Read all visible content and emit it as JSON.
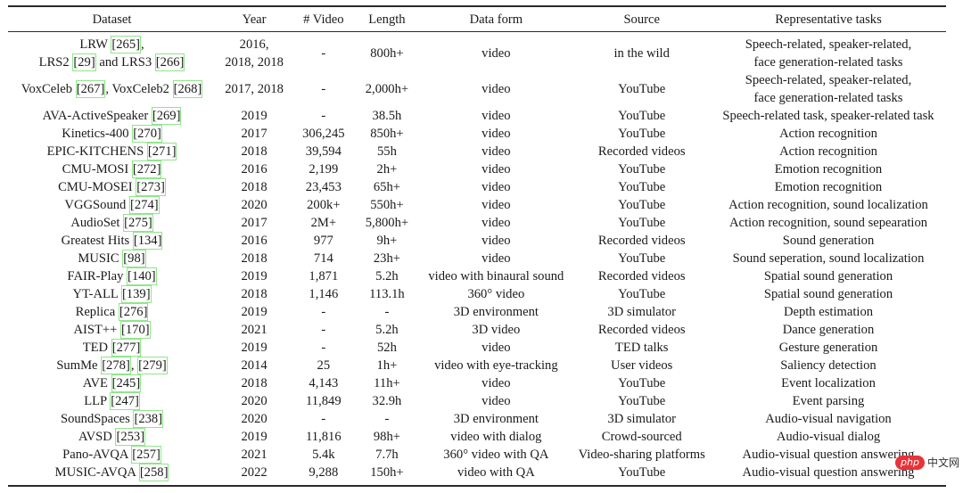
{
  "table": {
    "headers": [
      "Dataset",
      "Year",
      "# Video",
      "Length",
      "Data form",
      "Source",
      "Representative tasks"
    ],
    "rows": [
      {
        "dataset_lines": [
          [
            {
              "t": "LRW "
            },
            {
              "c": "[265]"
            },
            {
              "t": ","
            }
          ],
          [
            {
              "t": "LRS2 "
            },
            {
              "c": "[29]"
            },
            {
              "t": " and LRS3 "
            },
            {
              "c": "[266]"
            }
          ]
        ],
        "year": [
          "2016,",
          "2018, 2018"
        ],
        "num_video": "-",
        "length": "800h+",
        "data_form": "video",
        "source": "in the wild",
        "tasks": [
          "Speech-related, speaker-related,",
          "face generation-related tasks"
        ]
      },
      {
        "dataset_lines": [
          [
            {
              "t": "VoxCeleb "
            },
            {
              "c": "[267]"
            },
            {
              "t": ", VoxCeleb2 "
            },
            {
              "c": "[268]"
            }
          ]
        ],
        "year": [
          "2017, 2018"
        ],
        "num_video": "-",
        "length": "2,000h+",
        "data_form": "video",
        "source": "YouTube",
        "tasks": [
          "Speech-related, speaker-related,",
          "face generation-related tasks"
        ]
      },
      {
        "dataset_lines": [
          [
            {
              "t": "AVA-ActiveSpeaker "
            },
            {
              "c": "[269]"
            }
          ]
        ],
        "year": [
          "2019"
        ],
        "num_video": "-",
        "length": "38.5h",
        "data_form": "video",
        "source": "YouTube",
        "tasks": [
          "Speech-related task, speaker-related task"
        ]
      },
      {
        "dataset_lines": [
          [
            {
              "t": "Kinetics-400 "
            },
            {
              "c": "[270]"
            }
          ]
        ],
        "year": [
          "2017"
        ],
        "num_video": "306,245",
        "length": "850h+",
        "data_form": "video",
        "source": "YouTube",
        "tasks": [
          "Action recognition"
        ]
      },
      {
        "dataset_lines": [
          [
            {
              "t": "EPIC-KITCHENS "
            },
            {
              "c": "[271]"
            }
          ]
        ],
        "year": [
          "2018"
        ],
        "num_video": "39,594",
        "length": "55h",
        "data_form": "video",
        "source": "Recorded videos",
        "tasks": [
          "Action recognition"
        ]
      },
      {
        "dataset_lines": [
          [
            {
              "t": "CMU-MOSI "
            },
            {
              "c": "[272]"
            }
          ]
        ],
        "year": [
          "2016"
        ],
        "num_video": "2,199",
        "length": "2h+",
        "data_form": "video",
        "source": "YouTube",
        "tasks": [
          "Emotion recognition"
        ]
      },
      {
        "dataset_lines": [
          [
            {
              "t": "CMU-MOSEI "
            },
            {
              "c": "[273]"
            }
          ]
        ],
        "year": [
          "2018"
        ],
        "num_video": "23,453",
        "length": "65h+",
        "data_form": "video",
        "source": "YouTube",
        "tasks": [
          "Emotion recognition"
        ]
      },
      {
        "dataset_lines": [
          [
            {
              "t": "VGGSound "
            },
            {
              "c": "[274]"
            }
          ]
        ],
        "year": [
          "2020"
        ],
        "num_video": "200k+",
        "length": "550h+",
        "data_form": "video",
        "source": "YouTube",
        "tasks": [
          "Action recognition, sound localization"
        ]
      },
      {
        "dataset_lines": [
          [
            {
              "t": "AudioSet "
            },
            {
              "c": "[275]"
            }
          ]
        ],
        "year": [
          "2017"
        ],
        "num_video": "2M+",
        "length": "5,800h+",
        "data_form": "video",
        "source": "YouTube",
        "tasks": [
          "Action recognition, sound sepearation"
        ]
      },
      {
        "dataset_lines": [
          [
            {
              "t": "Greatest Hits "
            },
            {
              "c": "[134]"
            }
          ]
        ],
        "year": [
          "2016"
        ],
        "num_video": "977",
        "length": "9h+",
        "data_form": "video",
        "source": "Recorded videos",
        "tasks": [
          "Sound generation"
        ]
      },
      {
        "dataset_lines": [
          [
            {
              "t": "MUSIC "
            },
            {
              "c": "[98]"
            }
          ]
        ],
        "year": [
          "2018"
        ],
        "num_video": "714",
        "length": "23h+",
        "data_form": "video",
        "source": "YouTube",
        "tasks": [
          "Sound seperation, sound localization"
        ]
      },
      {
        "dataset_lines": [
          [
            {
              "t": "FAIR-Play "
            },
            {
              "c": "[140]"
            }
          ]
        ],
        "year": [
          "2019"
        ],
        "num_video": "1,871",
        "length": "5.2h",
        "data_form": "video with binaural sound",
        "source": "Recorded videos",
        "tasks": [
          "Spatial sound generation"
        ]
      },
      {
        "dataset_lines": [
          [
            {
              "t": "YT-ALL "
            },
            {
              "c": "[139]"
            }
          ]
        ],
        "year": [
          "2018"
        ],
        "num_video": "1,146",
        "length": "113.1h",
        "data_form": "360° video",
        "source": "YouTube",
        "tasks": [
          "Spatial sound generation"
        ]
      },
      {
        "dataset_lines": [
          [
            {
              "t": "Replica "
            },
            {
              "c": "[276]"
            }
          ]
        ],
        "year": [
          "2019"
        ],
        "num_video": "-",
        "length": "-",
        "data_form": "3D environment",
        "source": "3D simulator",
        "tasks": [
          "Depth estimation"
        ]
      },
      {
        "dataset_lines": [
          [
            {
              "t": "AIST++ "
            },
            {
              "c": "[170]"
            }
          ]
        ],
        "year": [
          "2021"
        ],
        "num_video": "-",
        "length": "5.2h",
        "data_form": "3D video",
        "source": "Recorded videos",
        "tasks": [
          "Dance generation"
        ]
      },
      {
        "dataset_lines": [
          [
            {
              "t": "TED "
            },
            {
              "c": "[277]"
            }
          ]
        ],
        "year": [
          "2019"
        ],
        "num_video": "-",
        "length": "52h",
        "data_form": "video",
        "source": "TED talks",
        "tasks": [
          "Gesture generation"
        ]
      },
      {
        "dataset_lines": [
          [
            {
              "t": "SumMe "
            },
            {
              "c": "[278]"
            },
            {
              "t": ", "
            },
            {
              "c": "[279]"
            }
          ]
        ],
        "year": [
          "2014"
        ],
        "num_video": "25",
        "length": "1h+",
        "data_form": "video with eye-tracking",
        "source": "User videos",
        "tasks": [
          "Saliency detection"
        ]
      },
      {
        "dataset_lines": [
          [
            {
              "t": "AVE "
            },
            {
              "c": "[245]"
            }
          ]
        ],
        "year": [
          "2018"
        ],
        "num_video": "4,143",
        "length": "11h+",
        "data_form": "video",
        "source": "YouTube",
        "tasks": [
          "Event localization"
        ]
      },
      {
        "dataset_lines": [
          [
            {
              "t": "LLP "
            },
            {
              "c": "[247]"
            }
          ]
        ],
        "year": [
          "2020"
        ],
        "num_video": "11,849",
        "length": "32.9h",
        "data_form": "video",
        "source": "YouTube",
        "tasks": [
          "Event parsing"
        ]
      },
      {
        "dataset_lines": [
          [
            {
              "t": "SoundSpaces "
            },
            {
              "c": "[238]"
            }
          ]
        ],
        "year": [
          "2020"
        ],
        "num_video": "-",
        "length": "-",
        "data_form": "3D environment",
        "source": "3D simulator",
        "tasks": [
          "Audio-visual navigation"
        ]
      },
      {
        "dataset_lines": [
          [
            {
              "t": "AVSD "
            },
            {
              "c": "[253]"
            }
          ]
        ],
        "year": [
          "2019"
        ],
        "num_video": "11,816",
        "length": "98h+",
        "data_form": "video with dialog",
        "source": "Crowd-sourced",
        "tasks": [
          "Audio-visual dialog"
        ]
      },
      {
        "dataset_lines": [
          [
            {
              "t": "Pano-AVQA "
            },
            {
              "c": "[257]"
            }
          ]
        ],
        "year": [
          "2021"
        ],
        "num_video": "5.4k",
        "length": "7.7h",
        "data_form": "360° video with QA",
        "source": "Video-sharing platforms",
        "tasks": [
          "Audio-visual question answering"
        ]
      },
      {
        "dataset_lines": [
          [
            {
              "t": "MUSIC-AVQA "
            },
            {
              "c": "[258]"
            }
          ]
        ],
        "year": [
          "2022"
        ],
        "num_video": "9,288",
        "length": "150h+",
        "data_form": "video with QA",
        "source": "YouTube",
        "tasks": [
          "Audio-visual question answering"
        ]
      }
    ]
  },
  "watermark": {
    "logo": "php",
    "text": "中文网"
  },
  "colors": {
    "citation_box": "#8fe68a",
    "rule": "#2a2a2a"
  }
}
